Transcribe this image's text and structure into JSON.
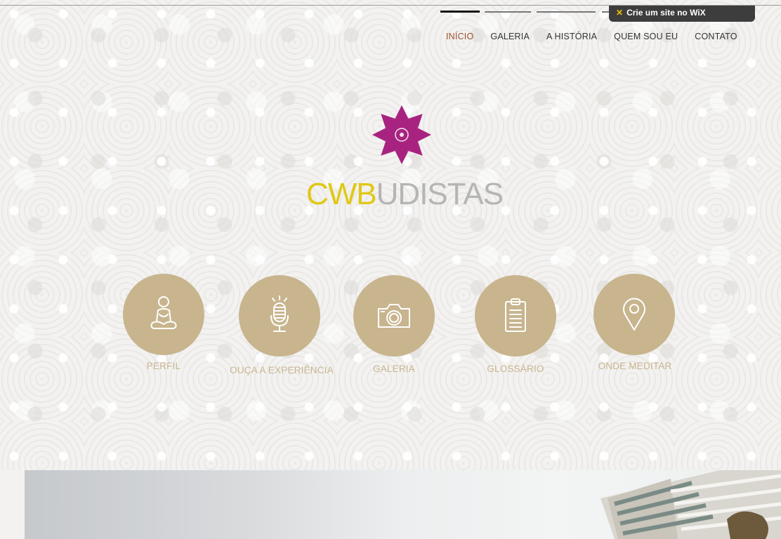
{
  "wix_badge": {
    "icon": "wix-x-icon",
    "label": "Crie um site no WiX"
  },
  "nav": [
    {
      "label": "INÍCIO",
      "active": true
    },
    {
      "label": "GALERIA",
      "active": false
    },
    {
      "label": "A HISTÓRIA",
      "active": false
    },
    {
      "label": "QUEM SOU EU",
      "active": false
    },
    {
      "label": "CONTATO",
      "active": false
    }
  ],
  "logo": {
    "text_part1": "CWB",
    "text_part2": "UDISTAS",
    "mark_icon": "lotus-flower-icon"
  },
  "features": [
    {
      "label": "PERFIL",
      "icon": "meditating-person-icon"
    },
    {
      "label": "OUÇA A EXPERIÊNCIA",
      "icon": "microphone-icon"
    },
    {
      "label": "GALERIA",
      "icon": "camera-icon"
    },
    {
      "label": "GLOSSÁRIO",
      "icon": "clipboard-icon"
    },
    {
      "label": "ONDE MEDITAR",
      "icon": "map-pin-icon"
    }
  ],
  "colors": {
    "accent": "#c8b58e",
    "logo_purple": "#a8237f",
    "logo_yellow": "#e0c816",
    "nav_active": "#a0522d"
  }
}
